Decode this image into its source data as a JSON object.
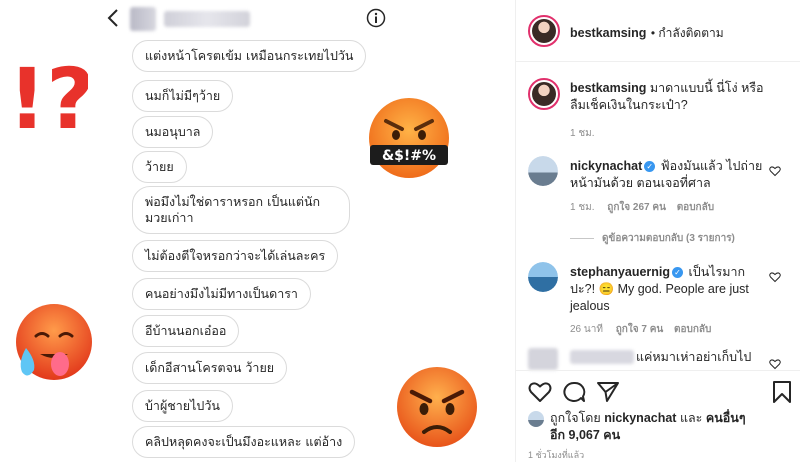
{
  "chat": {
    "messages": [
      "แต่งหน้าโครตเข้ม เหมือนกระเทยไปวัน",
      "นมก็ไม่มีๆว้าย",
      "นมอนุบาล",
      "ว้ายย",
      "พ่อมึงไม่ใช่ดาราหรอก เป็นแต่นักมวยเก่าา",
      "ไม่ต้องตีใจหรอกว่าจะได้เล่นละคร",
      "คนอย่างมึงไม่มีทางเป็นดารา",
      "อีบ้านนอกเอ๋ออ",
      "เด็กอีสานโครตจน ว้ายย",
      "บ้าผู้ชายไปวัน",
      "คลิปหลุดคงจะเป็นมึงอะแหละ แต่อ้าง"
    ],
    "emoji_censored_text": "&$!#%",
    "exclaim_text": "!?"
  },
  "post": {
    "author": "bestkamsing",
    "follow_status": "• กำลังติดตาม",
    "caption": "มาดาแบบนี้ นี่โง่ หรือลืมเช็คเงินในกระเป๋า?",
    "caption_time": "1 ชม.",
    "comments": [
      {
        "user": "nickynachat",
        "verified": true,
        "text": "ฟ้องมันแล้ว ไปถ่ายหน้ามันด้วย ตอนเจอที่ศาล",
        "time": "1 ชม.",
        "likes": "ถูกใจ 267 คน",
        "reply": "ตอบกลับ",
        "view_replies": "ดูข้อความตอบกลับ (3 รายการ)"
      },
      {
        "user": "stephanyauernig",
        "verified": true,
        "text": "เป็นไรมากปะ?! 😑 My god. People are just jealous",
        "time": "26 นาที",
        "likes": "ถูกใจ 7 คน",
        "reply": "ตอบกลับ"
      },
      {
        "user": "",
        "text": "แค่หมาเห่าอย่าเก็บไป"
      }
    ],
    "liked_by_prefix": "ถูกใจโดย",
    "liked_by_user": "nickynachat",
    "liked_by_and": "และ",
    "liked_by_others": "คนอื่นๆ อีก 9,067 คน",
    "posted_ago": "1 ชั่วโมงที่แล้ว"
  },
  "icons": {
    "back": "chevron-left-icon",
    "info": "info-icon",
    "like": "heart-icon",
    "comment": "comment-icon",
    "share": "share-icon",
    "save": "bookmark-icon"
  },
  "colors": {
    "verified": "#3897f0",
    "story_ring": "#e1306c",
    "exclaim": "#e8322b",
    "emoji_face": "#f7941d"
  }
}
